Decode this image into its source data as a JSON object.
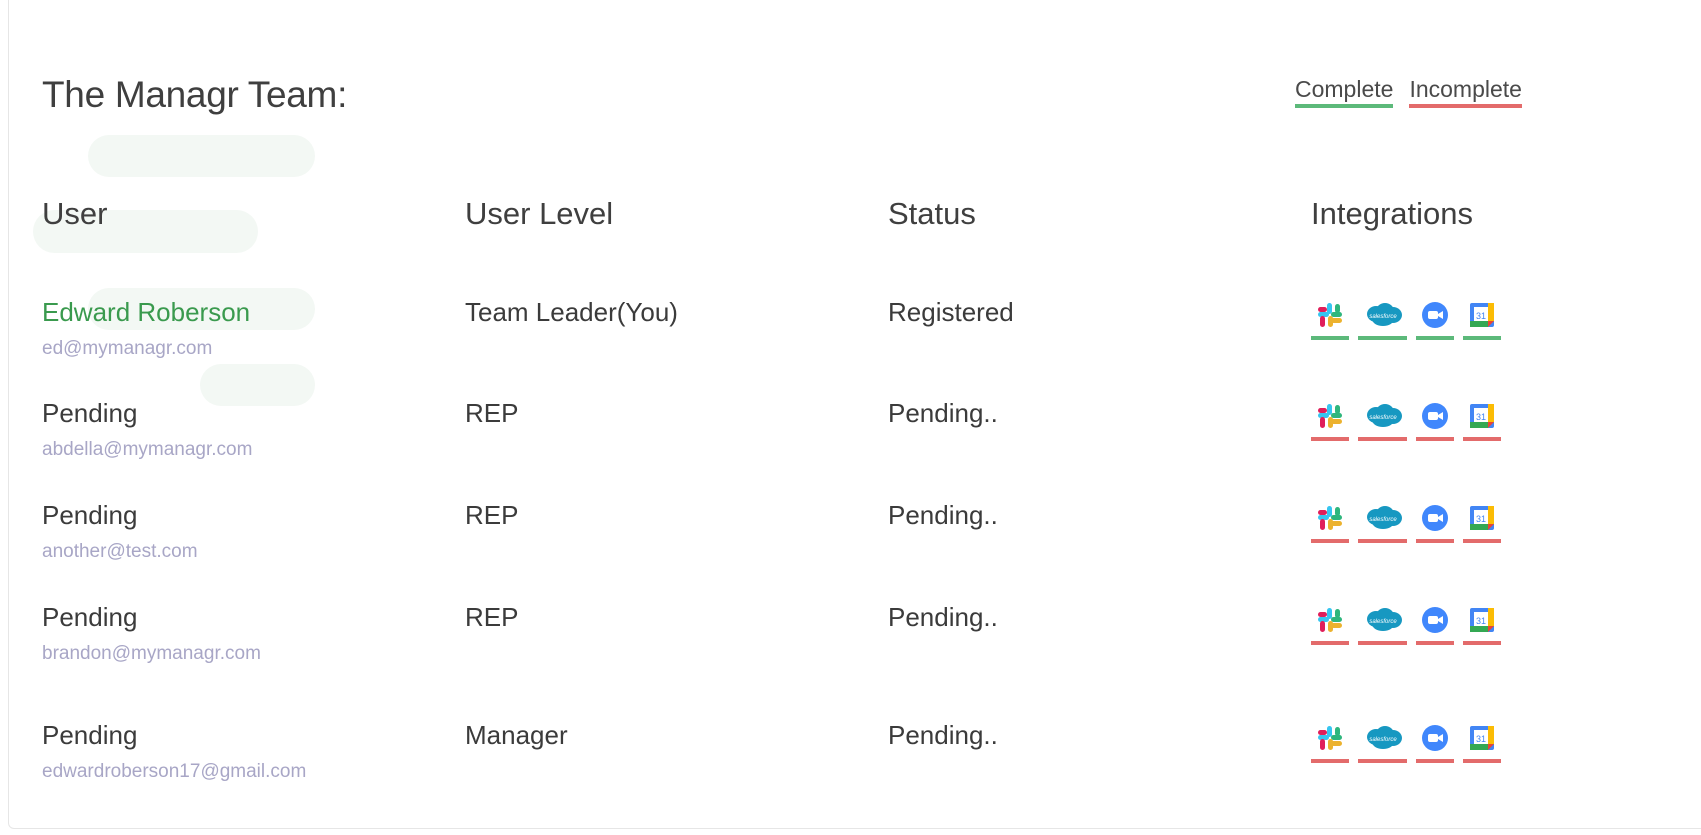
{
  "page": {
    "title": "The Managr Team:",
    "legend": {
      "complete": "Complete",
      "incomplete": "Incomplete"
    }
  },
  "columns": {
    "user": "User",
    "level": "User Level",
    "status": "Status",
    "integrations": "Integrations"
  },
  "colors": {
    "complete": "#5cb97a",
    "incomplete": "#e36b6b",
    "active_name": "#3a9a4e",
    "email": "#a8a6c6"
  },
  "integration_icons": [
    "slack-icon",
    "salesforce-icon",
    "zoom-icon",
    "google-calendar-icon"
  ],
  "users": [
    {
      "name": "Edward Roberson",
      "email": "ed@mymanagr.com",
      "level": "Team Leader(You)",
      "status": "Registered",
      "integrations_complete": true
    },
    {
      "name": "Pending",
      "email": "abdella@mymanagr.com",
      "level": "REP",
      "status": "Pending..",
      "integrations_complete": false
    },
    {
      "name": "Pending",
      "email": "another@test.com",
      "level": "REP",
      "status": "Pending..",
      "integrations_complete": false
    },
    {
      "name": "Pending",
      "email": "brandon@mymanagr.com",
      "level": "REP",
      "status": "Pending..",
      "integrations_complete": false
    },
    {
      "name": "Pending",
      "email": "edwardroberson17@gmail.com",
      "level": "Manager",
      "status": "Pending..",
      "integrations_complete": false
    }
  ]
}
